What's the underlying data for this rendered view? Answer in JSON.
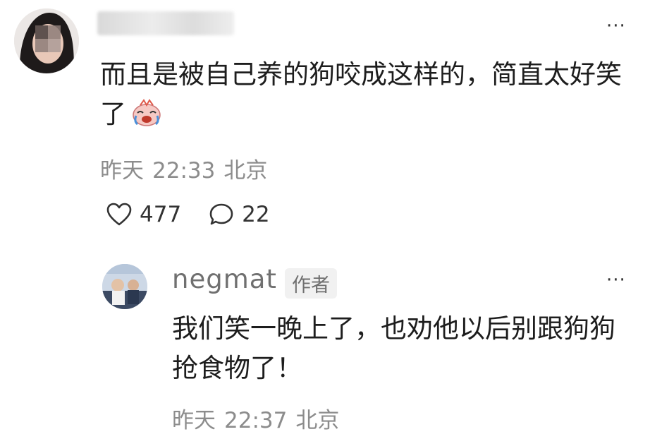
{
  "comment": {
    "text": "而且是被自己养的狗咬成这样的，简直太好笑了",
    "emoji": "laughing-crying-emoji",
    "date_label": "昨天",
    "time": "22:33",
    "location": "北京",
    "likes": "477",
    "replies": "22",
    "more_label": "···"
  },
  "reply": {
    "username": "negmat",
    "author_tag": "作者",
    "text": "我们笑一晚上了，也劝他以后别跟狗狗抢食物了！",
    "date_label": "昨天",
    "time": "22:37",
    "location": "北京",
    "more_label": "···"
  },
  "icons": {
    "like": "heart-outline-icon",
    "reply": "speech-bubble-icon",
    "more": "more-dots-icon"
  },
  "colors": {
    "text": "#1d1d1d",
    "meta": "#8c8c8c",
    "tag_bg": "#f1f1f1"
  }
}
